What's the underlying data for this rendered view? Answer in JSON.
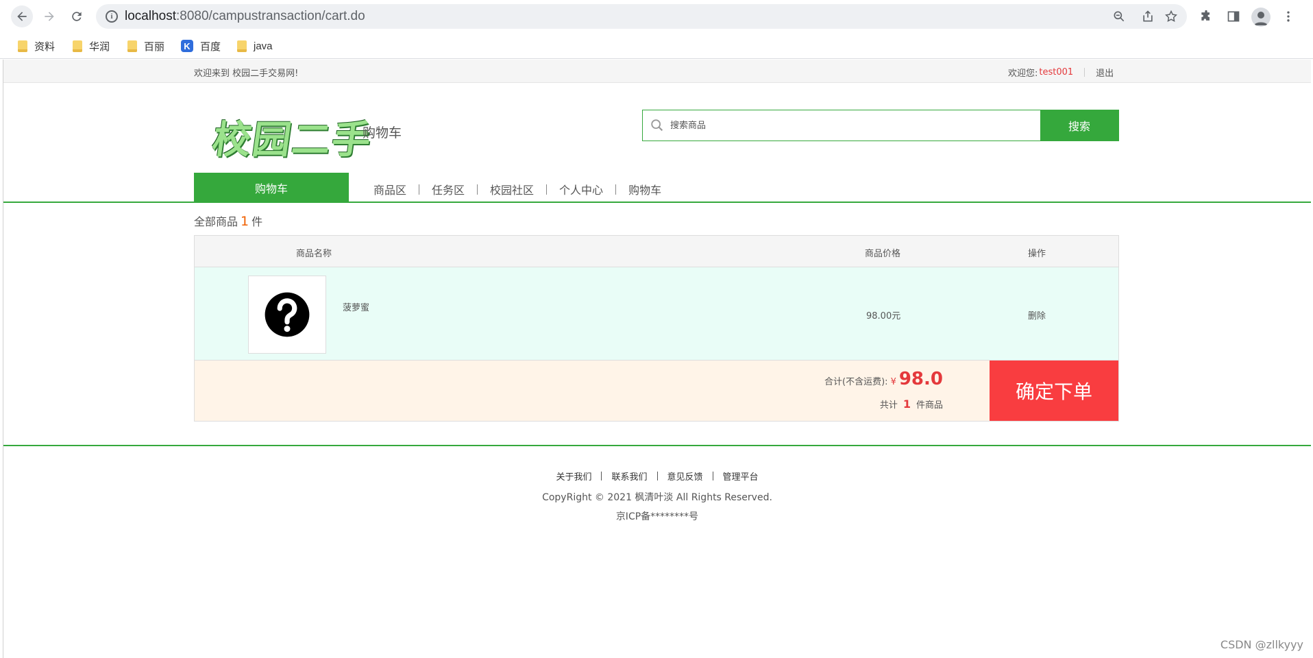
{
  "browser": {
    "url_host": "localhost",
    "url_path": ":8080/campustransaction/cart.do",
    "bookmarks": [
      {
        "label": "资料"
      },
      {
        "label": "华润"
      },
      {
        "label": "百丽"
      },
      {
        "label": "百度"
      },
      {
        "label": "java"
      }
    ]
  },
  "topbar": {
    "welcome": "欢迎来到 校园二手交易网!",
    "user_prefix": "欢迎您:",
    "username": "test001",
    "logout": "退出"
  },
  "header": {
    "logo_text": "校园二手",
    "subtitle": "购物车",
    "search_placeholder": "搜索商品",
    "search_button": "搜索"
  },
  "nav": {
    "active": "购物车",
    "links": [
      "商品区",
      "任务区",
      "校园社区",
      "个人中心",
      "购物车"
    ]
  },
  "cart": {
    "count_prefix": "全部商品",
    "count": "1",
    "count_suffix": "件",
    "columns": {
      "name": "商品名称",
      "price": "商品价格",
      "op": "操作"
    },
    "items": [
      {
        "name": "菠萝蜜",
        "price": "98.00元",
        "action": "删除"
      }
    ],
    "total_label": "合计(不含运费):",
    "currency": "¥",
    "total": "98.0",
    "qty_prefix": "共计",
    "qty": "1",
    "qty_suffix": "件商品",
    "order_button": "确定下单"
  },
  "footer": {
    "links": [
      "关于我们",
      "联系我们",
      "意见反馈",
      "管理平台"
    ],
    "copyright": "CopyRight © 2021 枫清叶淡 All Rights Reserved.",
    "icp": "京ICP备********号"
  },
  "watermark": "CSDN @zllkyyy",
  "colors": {
    "brand_green": "#35a83c",
    "accent_red": "#f93d40",
    "price_red": "#e4393c"
  }
}
